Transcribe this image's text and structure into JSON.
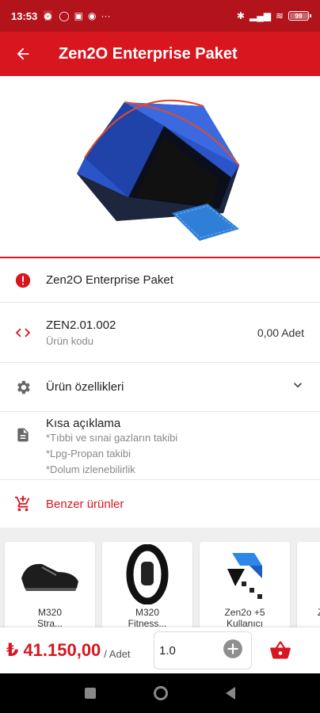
{
  "status": {
    "time": "13:53",
    "battery": "99"
  },
  "appbar": {
    "title": "Zen2O Enterprise Paket"
  },
  "product": {
    "name": "Zen2O Enterprise Paket",
    "code": "ZEN2.01.002",
    "code_label": "Ürün kodu",
    "stock": "0,00 Adet",
    "properties_label": "Ürün özellikleri",
    "desc_title": "Kısa açıklama",
    "desc_lines": [
      "*Tıbbi ve sınai gazların takibi",
      "*Lpg-Propan takibi",
      "*Dolum izlenebilirlik"
    ],
    "similar_label": "Benzer ürünler"
  },
  "similar": [
    {
      "label": "M320",
      "label2": "Stra..."
    },
    {
      "label": "M320",
      "label2": "Fitness..."
    },
    {
      "label": "Zen2o +5",
      "label2": "Kullanıcı"
    },
    {
      "label": "Z"
    }
  ],
  "bottom": {
    "price": "₺ 41.150,00",
    "unit": "/ Adet",
    "qty": "1.0"
  },
  "colors": {
    "accent": "#d7161f",
    "status": "#b3141c"
  }
}
